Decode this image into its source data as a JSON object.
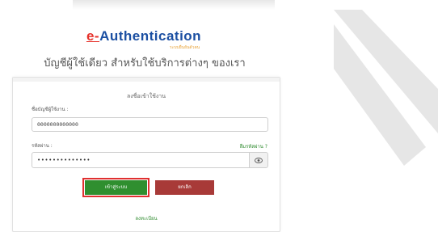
{
  "brand": {
    "logo_prefix": "e-",
    "logo_main": "Authentication",
    "logo_sub": "ระบบยืนยันตัวตน"
  },
  "tagline": "บัญชีผู้ใช้เดียว สำหรับใช้บริการต่างๆ ของเรา",
  "form": {
    "title": "ลงชื่อเข้าใช้งาน",
    "username_label": "ชื่อบัญชีผู้ใช้งาน :",
    "username_value": "0000000000000",
    "password_label": "รหัสผ่าน :",
    "forgot_link": "ลืมรหัสผ่าน ?",
    "password_value": "••••••••••••••",
    "show_password_icon": "eye-icon",
    "login_button": "เข้าสู่ระบบ",
    "cancel_button": "ยกเลิก",
    "register_link": "ลงทะเบียน"
  },
  "colors": {
    "logo_blue": "#1b4fa2",
    "logo_red": "#e6322b",
    "login_green": "#2f8f2f",
    "cancel_red": "#a83a38",
    "highlight": "#e03030"
  }
}
